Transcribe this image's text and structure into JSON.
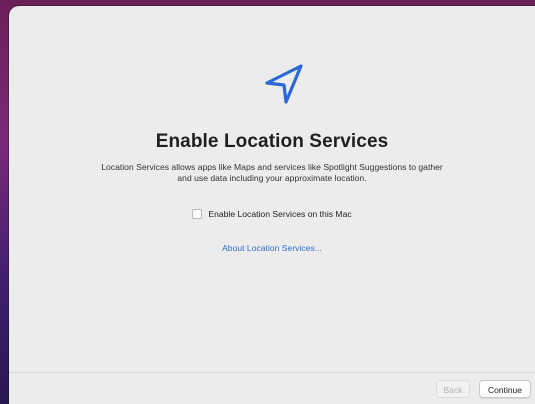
{
  "setup": {
    "title": "Enable Location Services",
    "description": "Location Services allows apps like Maps and services like Spotlight Suggestions to gather and use data including your approximate location.",
    "checkbox_label": "Enable Location Services on this Mac",
    "checkbox_checked": false,
    "about_link": "About Location Services...",
    "icon": "location-arrow-icon"
  },
  "footer": {
    "back_label": "Back",
    "back_enabled": false,
    "continue_label": "Continue"
  },
  "colors": {
    "accent": "#2f6fd3",
    "icon_stroke": "#2a67d8",
    "window_bg": "#ececec"
  }
}
